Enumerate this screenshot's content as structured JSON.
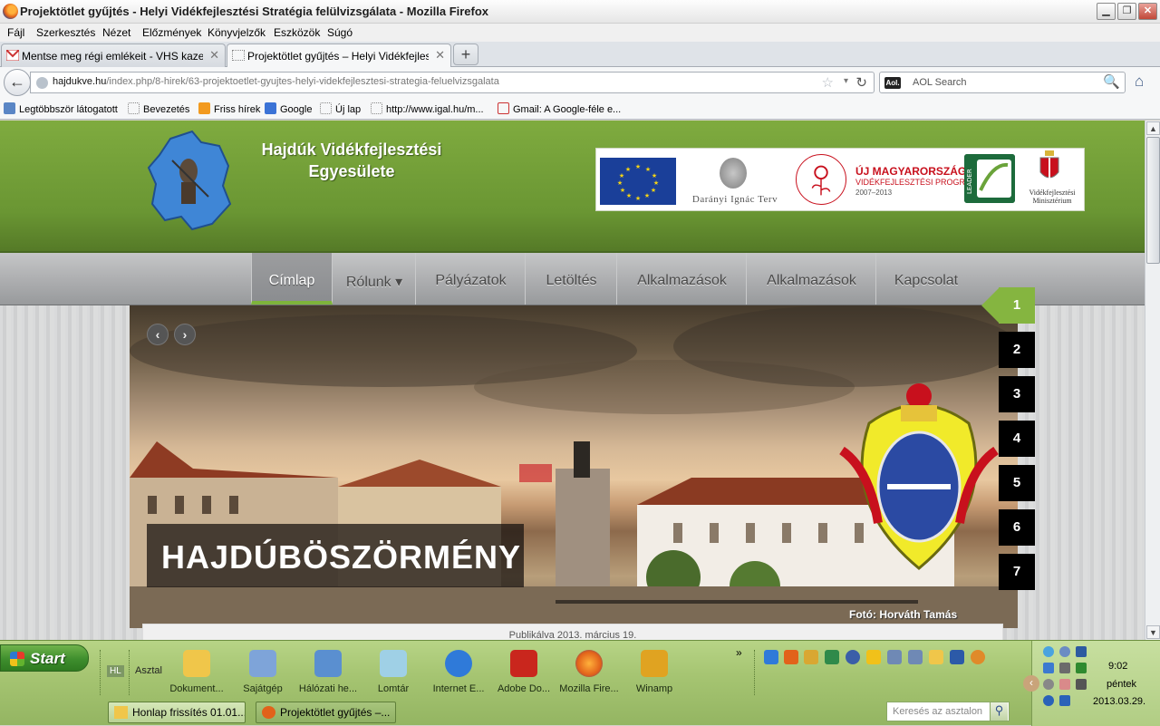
{
  "window": {
    "title": "Projektötlet gyűjtés - Helyi Vidékfejlesztési Stratégia felülvizsgálata - Mozilla Firefox",
    "minimize": "▁",
    "maximize": "❐",
    "close": "✕"
  },
  "menu": {
    "items": [
      "Fájl",
      "Szerkesztés",
      "Nézet",
      "Előzmények",
      "Könyvjelzők",
      "Eszközök",
      "Súgó"
    ]
  },
  "tabs": [
    {
      "label": "Mentse meg régi emlékeit - VHS kazettár...",
      "close": "✕"
    },
    {
      "label": "Projektötlet gyűjtés – Helyi Vidékfejleszt...",
      "close": "✕"
    }
  ],
  "new_tab": "+",
  "navbar": {
    "back": "←",
    "url_domain": "hajdukve.hu",
    "url_path": "/index.php/8-hirek/63-projektoetlet-gyujtes-helyi-videkfejlesztesi-strategia-feluelvizsgalata",
    "star": "☆",
    "dropdown": "▾",
    "reload": "↻",
    "search_engine": "Aol.",
    "search_placeholder": "AOL Search",
    "search_icon": "🔍",
    "home": "⌂"
  },
  "bookmarks": [
    "Legtöbbször látogatott",
    "Bevezetés",
    "Friss hírek",
    "Google",
    "Új lap",
    "http://www.igal.hu/m...",
    "Gmail: A Google-féle e..."
  ],
  "site": {
    "org_line1": "Hajdúk Vidékfejlesztési",
    "org_line2": "Egyesülete",
    "sponsor": {
      "darany": "Darányi Ignác Terv",
      "um_title": "ÚJ MAGYARORSZÁG",
      "um_sub": "VIDÉKFEJLESZTÉSI PROGRAM",
      "um_years": "2007–2013",
      "leader": "LEADER",
      "vm_line1": "Vidékfejlesztési",
      "vm_line2": "Minisztérium"
    },
    "nav": [
      {
        "label": "Címlap",
        "active": true
      },
      {
        "label": "Rólunk ▾",
        "active": false
      },
      {
        "label": "Pályázatok",
        "active": false
      },
      {
        "label": "Letöltés",
        "active": false
      },
      {
        "label": "Alkalmazások",
        "active": false
      },
      {
        "label": "Alkalmazások",
        "active": false
      },
      {
        "label": "Kapcsolat",
        "active": false
      }
    ],
    "slider": {
      "prev": "‹",
      "next": "›",
      "caption": "HAJDÚBÖSZÖRMÉNY",
      "credit": "Fotó: Horváth Tamás",
      "numbers": [
        "1",
        "2",
        "3",
        "4",
        "5",
        "6",
        "7"
      ],
      "active_index": 0
    },
    "published": "Publikálva 2013. március 19."
  },
  "taskbar": {
    "start": "Start",
    "hl": "HL",
    "desktop_label": "Asztal",
    "desktop_icons": [
      {
        "label": "Dokument...",
        "color": "#f0c64a"
      },
      {
        "label": "Sajátgép",
        "color": "#7ea4d9"
      },
      {
        "label": "Hálózati he...",
        "color": "#5a8fd0"
      },
      {
        "label": "Lomtár",
        "color": "#9fd0e6"
      },
      {
        "label": "Internet E...",
        "color": "#2f7ad9"
      },
      {
        "label": "Adobe Do...",
        "color": "#c9261d"
      },
      {
        "label": "Mozilla Fire...",
        "color": "#e2621a"
      },
      {
        "label": "Winamp",
        "color": "#e0a321"
      }
    ],
    "more": "»",
    "tasks": [
      {
        "label": "Honlap frissítés 01.01....",
        "active": false
      },
      {
        "label": "Projektötlet gyűjtés –...",
        "active": true
      }
    ],
    "desktop_search_placeholder": "Keresés az asztalon",
    "clock_time": "9:02",
    "clock_day": "péntek",
    "clock_date": "2013.03.29."
  }
}
